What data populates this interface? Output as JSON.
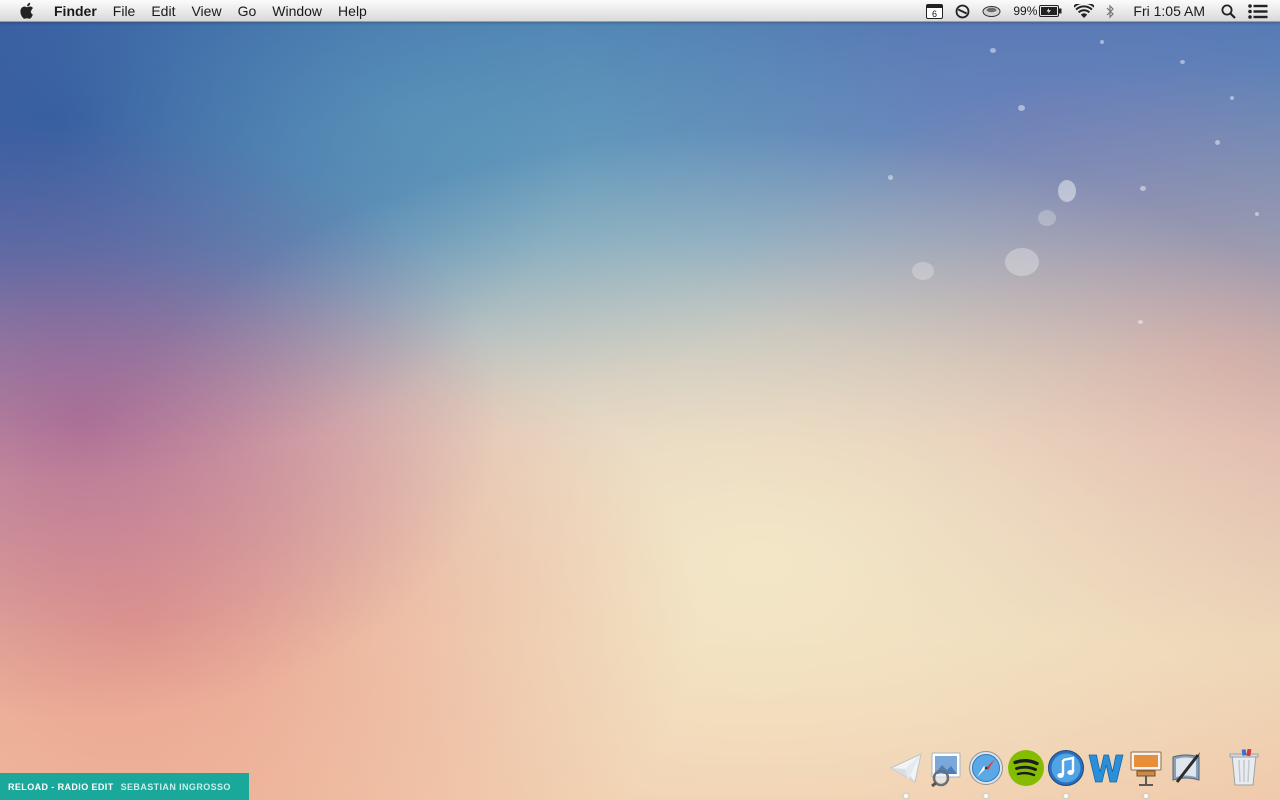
{
  "menubar": {
    "apple_icon": "apple-icon",
    "menus": [
      "Finder",
      "File",
      "Edit",
      "View",
      "Go",
      "Window",
      "Help"
    ],
    "status": {
      "calendar_day": "6",
      "battery_percent": "99%",
      "clock": "Fri 1:05 AM"
    }
  },
  "now_playing": {
    "track": "RELOAD - RADIO EDIT",
    "artist": "SEBASTIAN INGROSSO"
  },
  "dock": {
    "apps": [
      {
        "icon": "paper-plane-icon",
        "running": true
      },
      {
        "icon": "preview-icon",
        "running": false
      },
      {
        "icon": "safari-icon",
        "running": true
      },
      {
        "icon": "spotify-icon",
        "running": false
      },
      {
        "icon": "itunes-icon",
        "running": true
      },
      {
        "icon": "word-icon",
        "running": false
      },
      {
        "icon": "keynote-icon",
        "running": true
      },
      {
        "icon": "script-editor-icon",
        "running": false
      }
    ],
    "trash_icon": "trash-icon"
  },
  "colors": {
    "menubar": "#e9e9e9",
    "now_playing_bg": "#19a89a",
    "spotify_green": "#84bd00",
    "word_blue": "#2a8fd8"
  }
}
